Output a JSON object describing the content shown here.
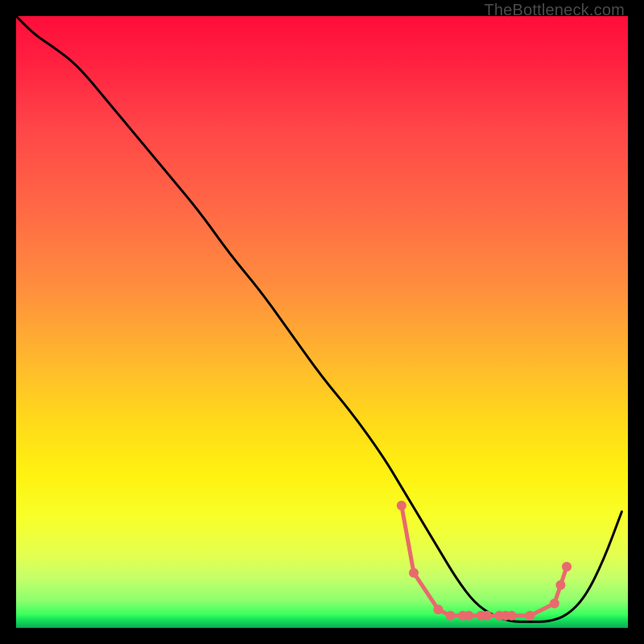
{
  "watermark": "TheBottleneck.com",
  "chart_data": {
    "type": "line",
    "title": "",
    "xlabel": "",
    "ylabel": "",
    "xlim": [
      0,
      100
    ],
    "ylim": [
      0,
      100
    ],
    "grid": false,
    "legend": false,
    "series": [
      {
        "name": "bottleneck-curve",
        "color": "#000000",
        "x": [
          0,
          3,
          6,
          10,
          15,
          20,
          25,
          30,
          35,
          40,
          45,
          50,
          55,
          60,
          63,
          66,
          69,
          72,
          75,
          78,
          81,
          84,
          87,
          90,
          93,
          96,
          99
        ],
        "values": [
          100,
          97,
          95,
          92,
          86,
          80,
          74,
          68,
          61,
          55,
          48,
          41,
          35,
          28,
          23,
          18,
          13,
          8,
          4,
          2,
          1,
          1,
          1,
          2,
          5,
          11,
          19
        ]
      }
    ],
    "markers": {
      "name": "bottleneck-range",
      "color": "#e86a6d",
      "radius": 6,
      "x": [
        63,
        65,
        69,
        71,
        73,
        74,
        76,
        77,
        79,
        80,
        81,
        84,
        88,
        89,
        90
      ],
      "y": [
        20,
        9,
        3,
        2,
        2,
        2,
        2,
        2,
        2,
        2,
        2,
        2,
        4,
        7,
        10
      ]
    }
  }
}
